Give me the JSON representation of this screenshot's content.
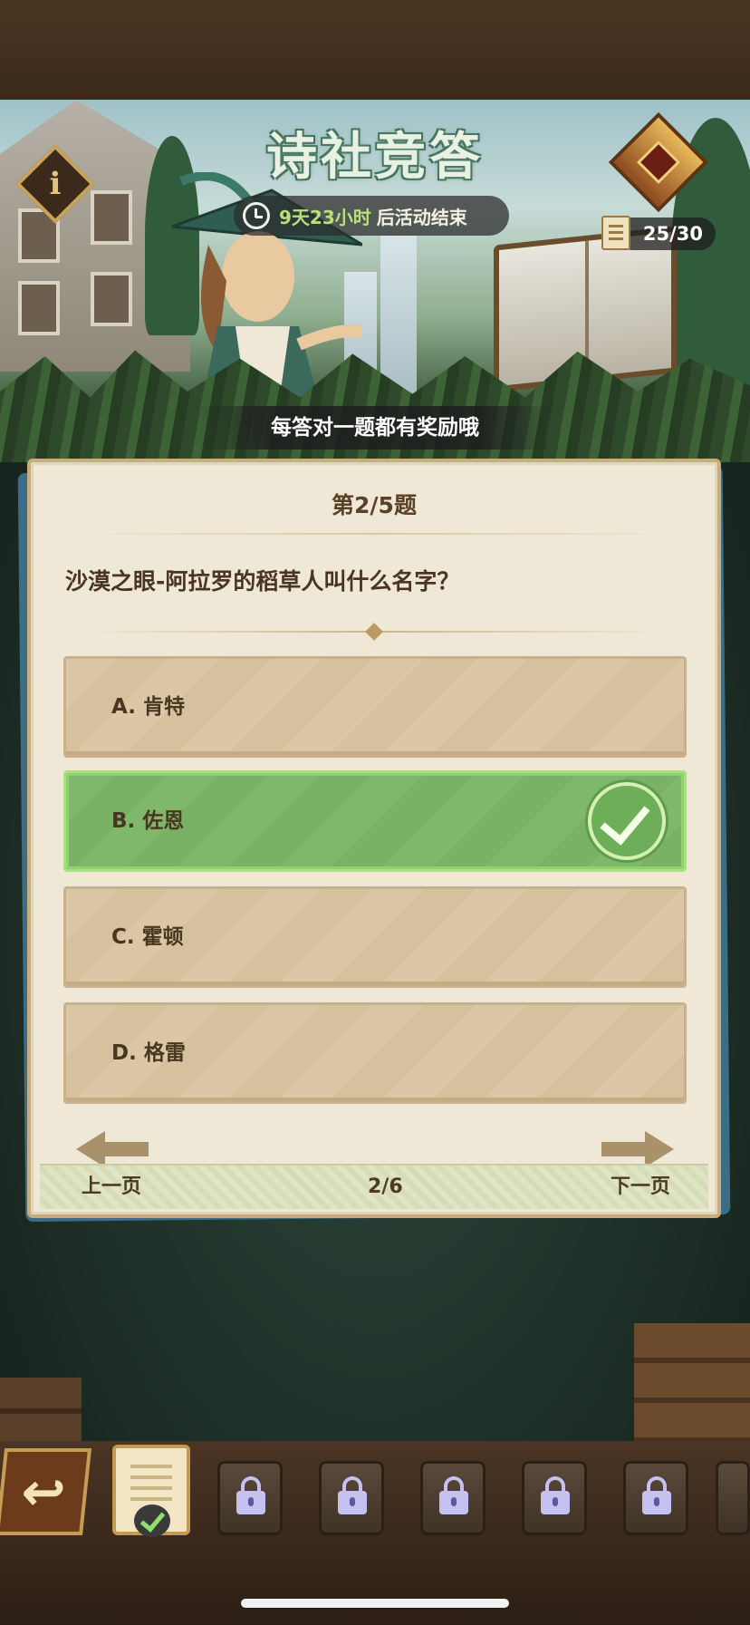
{
  "header": {
    "title": "诗社竞答",
    "timer_value": "9天23小时",
    "timer_suffix": "后活动结束",
    "progress_count": "25/30",
    "reward_hint": "每答对一题都有奖励哦"
  },
  "question": {
    "number_label": "第2/5题",
    "text": "沙漠之眼-阿拉罗的稻草人叫什么名字？",
    "options": [
      {
        "label": "A. 肯特",
        "selected": false
      },
      {
        "label": "B. 佐恩",
        "selected": true
      },
      {
        "label": "C. 霍顿",
        "selected": false
      },
      {
        "label": "D. 格雷",
        "selected": false
      }
    ]
  },
  "pager": {
    "prev_label": "上一页",
    "page_indicator": "2/6",
    "next_label": "下一页"
  },
  "bottom_bar": {
    "back_icon": "back-arrow-icon",
    "completed_slots": 1,
    "locked_slots": 6
  },
  "colors": {
    "selected_option": "#7fb86a",
    "option_bg": "#dbc7a6",
    "card_bg": "#efe8d6",
    "timer_accent": "#b8e07a"
  }
}
